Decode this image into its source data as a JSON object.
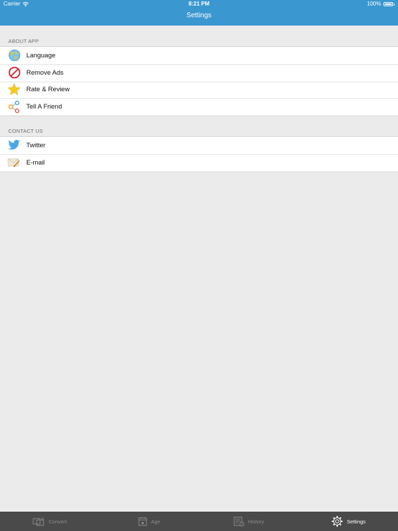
{
  "status_bar": {
    "carrier": "Carrier",
    "time": "8:21 PM",
    "battery": "100%"
  },
  "nav": {
    "title": "Settings"
  },
  "sections": {
    "about": {
      "header": "ABOUT APP",
      "items": [
        {
          "label": "Language",
          "icon": "globe-icon"
        },
        {
          "label": "Remove Ads",
          "icon": "no-ads-icon"
        },
        {
          "label": "Rate & Review",
          "icon": "star-icon"
        },
        {
          "label": "Tell A Friend",
          "icon": "share-icon"
        }
      ]
    },
    "contact": {
      "header": "CONTACT US",
      "items": [
        {
          "label": "Twitter",
          "icon": "twitter-bird-icon"
        },
        {
          "label": "E-mail",
          "icon": "envelope-icon"
        }
      ]
    }
  },
  "tabbar": {
    "active": "Settings",
    "tabs": [
      {
        "label": "Convert",
        "icon": "convert-icon"
      },
      {
        "label": "Age",
        "icon": "calendar-icon"
      },
      {
        "label": "History",
        "icon": "history-icon"
      },
      {
        "label": "Settings",
        "icon": "gear-icon"
      }
    ]
  },
  "colors": {
    "nav_bar": "#3b97cf",
    "background": "#ebebeb",
    "tab_bar": "#4a4a4a",
    "tab_inactive": "#8b8b8b",
    "tab_active": "#ffffff"
  }
}
